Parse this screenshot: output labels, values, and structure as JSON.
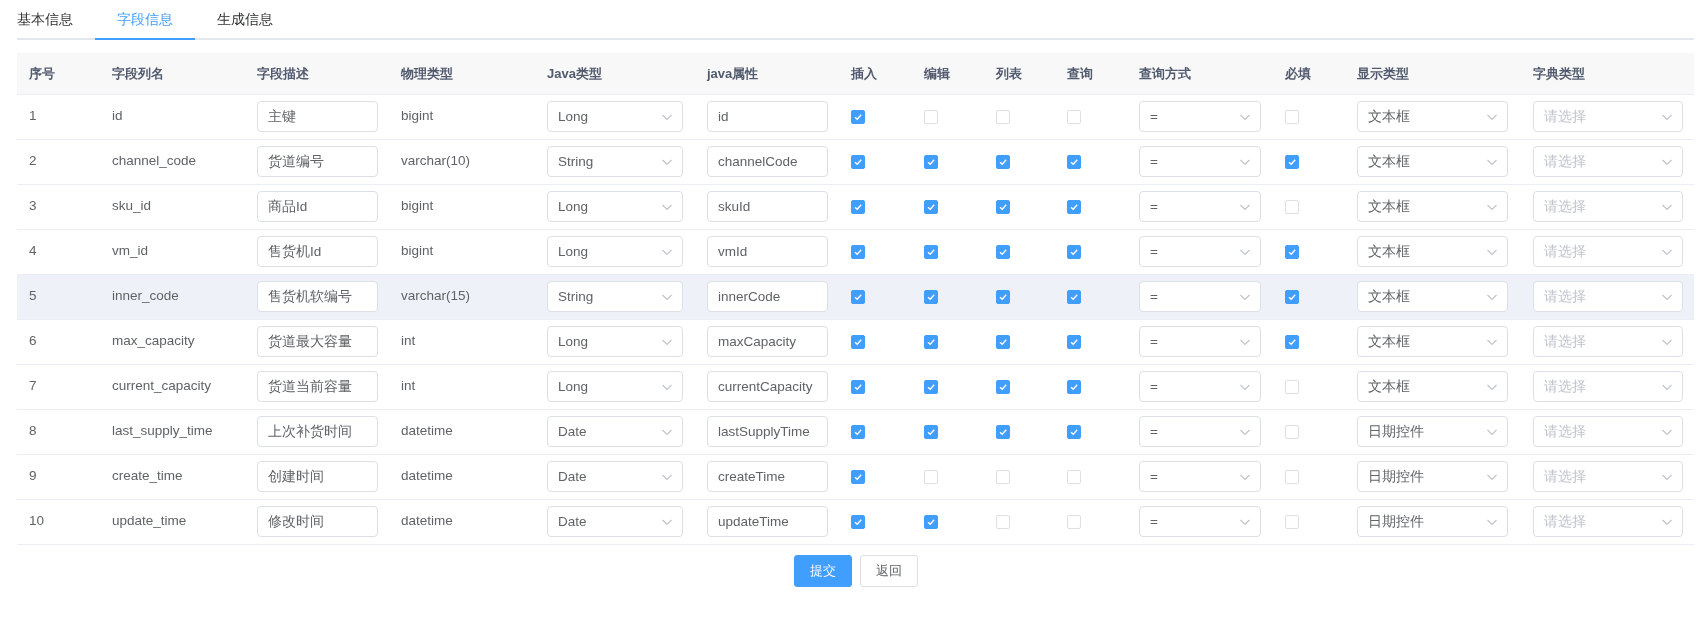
{
  "tabs": [
    {
      "label": "基本信息",
      "selected": false
    },
    {
      "label": "字段信息",
      "selected": true
    },
    {
      "label": "生成信息",
      "selected": false
    }
  ],
  "table": {
    "columns": [
      "序号",
      "字段列名",
      "字段描述",
      "物理类型",
      "Java类型",
      "java属性",
      "插入",
      "编辑",
      "列表",
      "查询",
      "查询方式",
      "必填",
      "显示类型",
      "字典类型"
    ],
    "rows": [
      {
        "index": "1",
        "column_name": "id",
        "description": "主键",
        "physical_type": "bigint",
        "java_type": "Long",
        "java_field": "id",
        "insert": true,
        "edit": false,
        "list": false,
        "query": false,
        "query_type": "=",
        "required": false,
        "display_type": "文本框",
        "dict_type_placeholder": "请选择",
        "hovered": false
      },
      {
        "index": "2",
        "column_name": "channel_code",
        "description": "货道编号",
        "physical_type": "varchar(10)",
        "java_type": "String",
        "java_field": "channelCode",
        "insert": true,
        "edit": true,
        "list": true,
        "query": true,
        "query_type": "=",
        "required": true,
        "display_type": "文本框",
        "dict_type_placeholder": "请选择",
        "hovered": false
      },
      {
        "index": "3",
        "column_name": "sku_id",
        "description": "商品Id",
        "physical_type": "bigint",
        "java_type": "Long",
        "java_field": "skuId",
        "insert": true,
        "edit": true,
        "list": true,
        "query": true,
        "query_type": "=",
        "required": false,
        "display_type": "文本框",
        "dict_type_placeholder": "请选择",
        "hovered": false
      },
      {
        "index": "4",
        "column_name": "vm_id",
        "description": "售货机Id",
        "physical_type": "bigint",
        "java_type": "Long",
        "java_field": "vmId",
        "insert": true,
        "edit": true,
        "list": true,
        "query": true,
        "query_type": "=",
        "required": true,
        "display_type": "文本框",
        "dict_type_placeholder": "请选择",
        "hovered": false
      },
      {
        "index": "5",
        "column_name": "inner_code",
        "description": "售货机软编号",
        "physical_type": "varchar(15)",
        "java_type": "String",
        "java_field": "innerCode",
        "insert": true,
        "edit": true,
        "list": true,
        "query": true,
        "query_type": "=",
        "required": true,
        "display_type": "文本框",
        "dict_type_placeholder": "请选择",
        "hovered": true
      },
      {
        "index": "6",
        "column_name": "max_capacity",
        "description": "货道最大容量",
        "physical_type": "int",
        "java_type": "Long",
        "java_field": "maxCapacity",
        "insert": true,
        "edit": true,
        "list": true,
        "query": true,
        "query_type": "=",
        "required": true,
        "display_type": "文本框",
        "dict_type_placeholder": "请选择",
        "hovered": false
      },
      {
        "index": "7",
        "column_name": "current_capacity",
        "description": "货道当前容量",
        "physical_type": "int",
        "java_type": "Long",
        "java_field": "currentCapacity",
        "insert": true,
        "edit": true,
        "list": true,
        "query": true,
        "query_type": "=",
        "required": false,
        "display_type": "文本框",
        "dict_type_placeholder": "请选择",
        "hovered": false
      },
      {
        "index": "8",
        "column_name": "last_supply_time",
        "description": "上次补货时间",
        "physical_type": "datetime",
        "java_type": "Date",
        "java_field": "lastSupplyTime",
        "insert": true,
        "edit": true,
        "list": true,
        "query": true,
        "query_type": "=",
        "required": false,
        "display_type": "日期控件",
        "dict_type_placeholder": "请选择",
        "hovered": false
      },
      {
        "index": "9",
        "column_name": "create_time",
        "description": "创建时间",
        "physical_type": "datetime",
        "java_type": "Date",
        "java_field": "createTime",
        "insert": true,
        "edit": false,
        "list": false,
        "query": false,
        "query_type": "=",
        "required": false,
        "display_type": "日期控件",
        "dict_type_placeholder": "请选择",
        "hovered": false
      },
      {
        "index": "10",
        "column_name": "update_time",
        "description": "修改时间",
        "physical_type": "datetime",
        "java_type": "Date",
        "java_field": "updateTime",
        "insert": true,
        "edit": true,
        "list": false,
        "query": false,
        "query_type": "=",
        "required": false,
        "display_type": "日期控件",
        "dict_type_placeholder": "请选择",
        "hovered": false
      }
    ]
  },
  "buttons": [
    {
      "label": "提交",
      "kind": "primary"
    },
    {
      "label": "返回",
      "kind": "default"
    }
  ]
}
